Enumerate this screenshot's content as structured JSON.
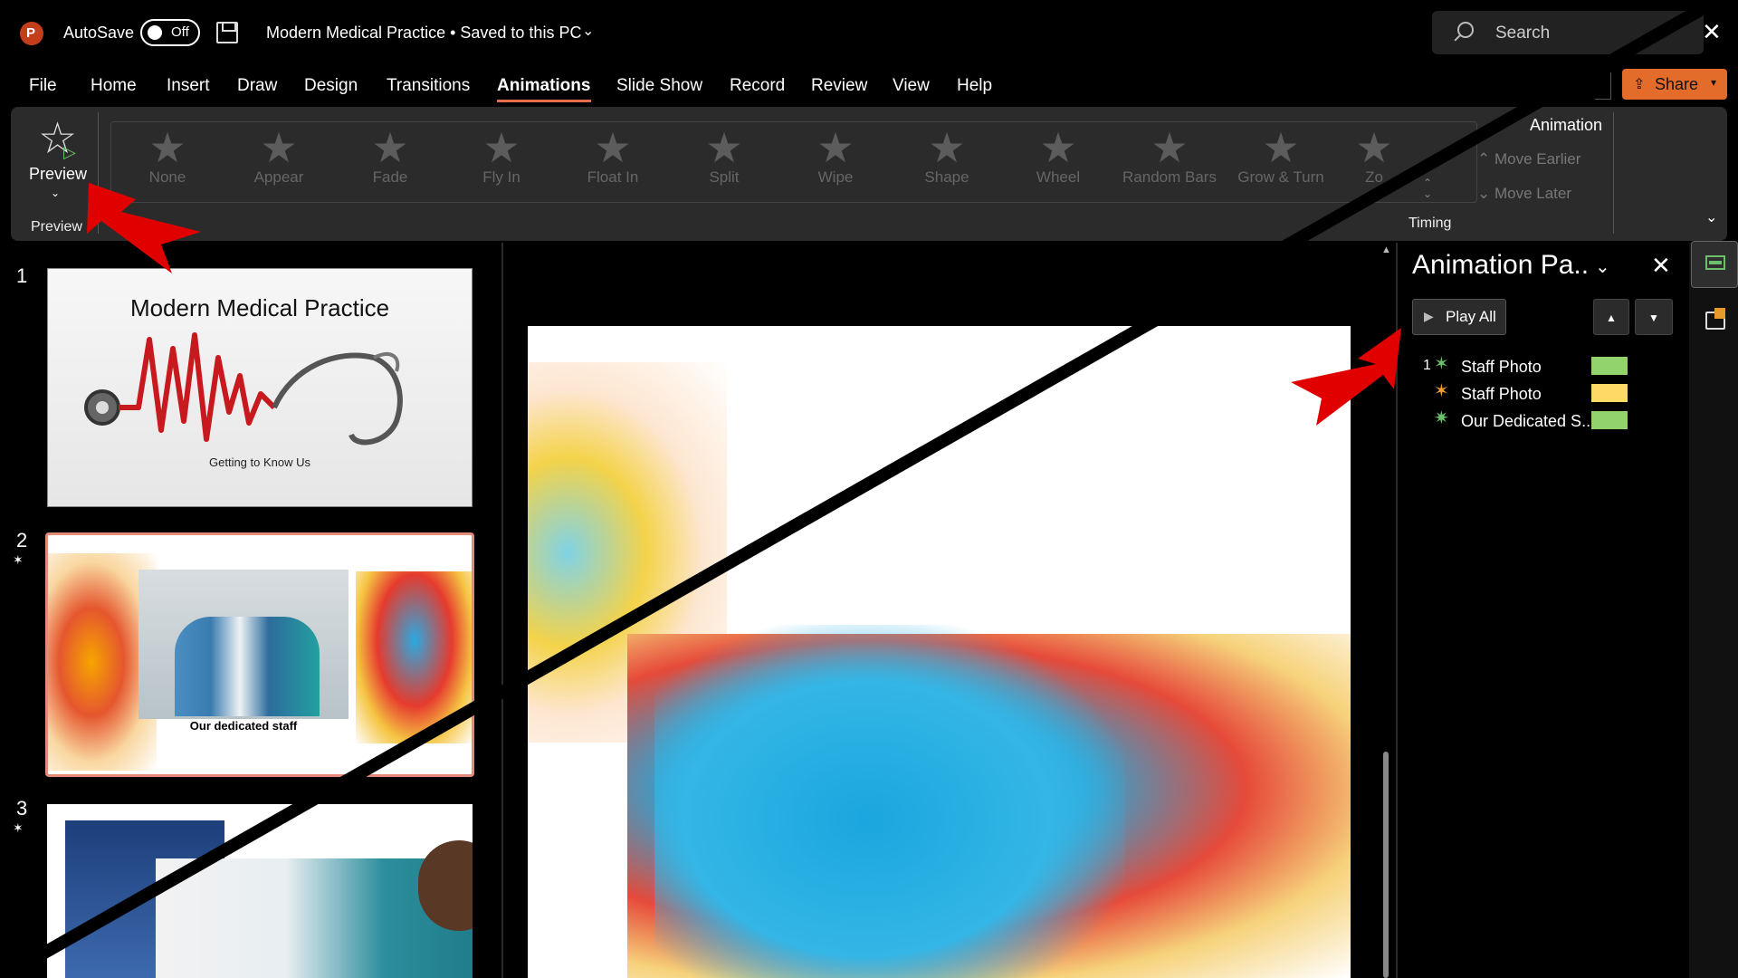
{
  "titlebar": {
    "app_icon_letter": "P",
    "autosave_label": "AutoSave",
    "autosave_state": "Off",
    "doc_title": "Modern Medical Practice • Saved to this PC",
    "search_placeholder": "Search"
  },
  "menu": {
    "items": [
      "File",
      "Home",
      "Insert",
      "Draw",
      "Design",
      "Transitions",
      "Animations",
      "Slide Show",
      "Record",
      "Review",
      "View",
      "Help"
    ],
    "active": "Animations",
    "share_label": "Share"
  },
  "ribbon": {
    "preview_label": "Preview",
    "preview_group": "Preview",
    "animations": [
      "None",
      "Appear",
      "Fade",
      "Fly In",
      "Float In",
      "Split",
      "Wipe",
      "Shape",
      "Wheel",
      "Random Bars",
      "Grow & Turn",
      "Zo"
    ],
    "animation_pane_label": "Animation",
    "move_earlier": "Move Earlier",
    "move_later": "Move Later",
    "timing_group": "Timing"
  },
  "thumbnails": {
    "slides": [
      {
        "number": "1",
        "has_animation": false,
        "title": "Modern Medical Practice",
        "subtitle": "Getting to Know Us"
      },
      {
        "number": "2",
        "has_animation": true,
        "caption": "Our dedicated staff"
      },
      {
        "number": "3",
        "has_animation": true
      }
    ]
  },
  "animation_pane": {
    "title": "Animation Pa..",
    "play_all": "Play All",
    "items": [
      {
        "order": "1",
        "name": "Staff Photo",
        "icon": "fly-in-icon",
        "color": "#92d36e"
      },
      {
        "order": "",
        "name": "Staff Photo",
        "icon": "emphasis-icon",
        "color": "#ffd966"
      },
      {
        "order": "",
        "name": "Our Dedicated S...",
        "icon": "appear-icon",
        "color": "#92d36e"
      }
    ]
  },
  "colors": {
    "accent": "#e46c4b",
    "share": "#e46c2b",
    "annotation_arrow": "#e00000"
  }
}
